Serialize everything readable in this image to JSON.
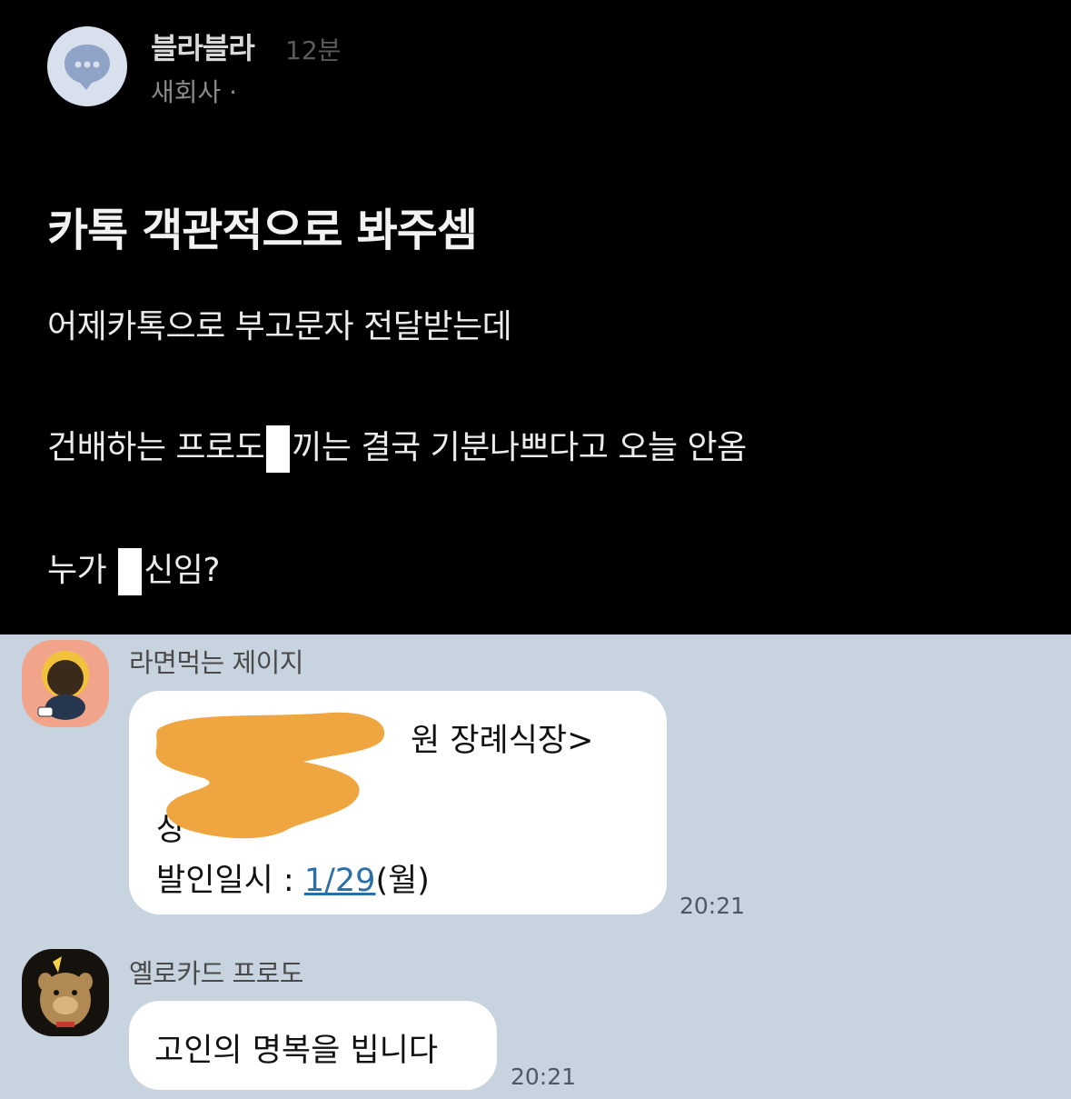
{
  "post": {
    "author": "블라블라",
    "time": "12분",
    "company": "새회사 ·",
    "title": "카톡 객관적으로 봐주셈",
    "lines": [
      {
        "before": "어제카톡으로 부고문자 전달받는데",
        "after": ""
      },
      {
        "before": "건배하는 프로도",
        "after": "끼는 결국 기분나쁘다고 오늘 안옴"
      },
      {
        "before": "누가 ",
        "after": "신임?"
      }
    ]
  },
  "chat": {
    "messages": [
      {
        "sender": "라면먹는 제이지",
        "lines": [
          "원 장례식장>",
          "상",
          "발인일시 : "
        ],
        "date_link": "1/29",
        "date_suffix": "(월)",
        "time": "20:21"
      },
      {
        "sender": "옐로카드 프로도",
        "text": "고인의 명복을 빕니다",
        "time": "20:21"
      }
    ]
  },
  "colors": {
    "post_bg": "#000000",
    "chat_bg": "#c7d3df",
    "bubble": "#ffffff",
    "redaction": "#f0a640",
    "link": "#2c6ea8"
  },
  "icons": [
    "chat-bubble-icon",
    "jay-g-avatar",
    "frodo-avatar"
  ]
}
